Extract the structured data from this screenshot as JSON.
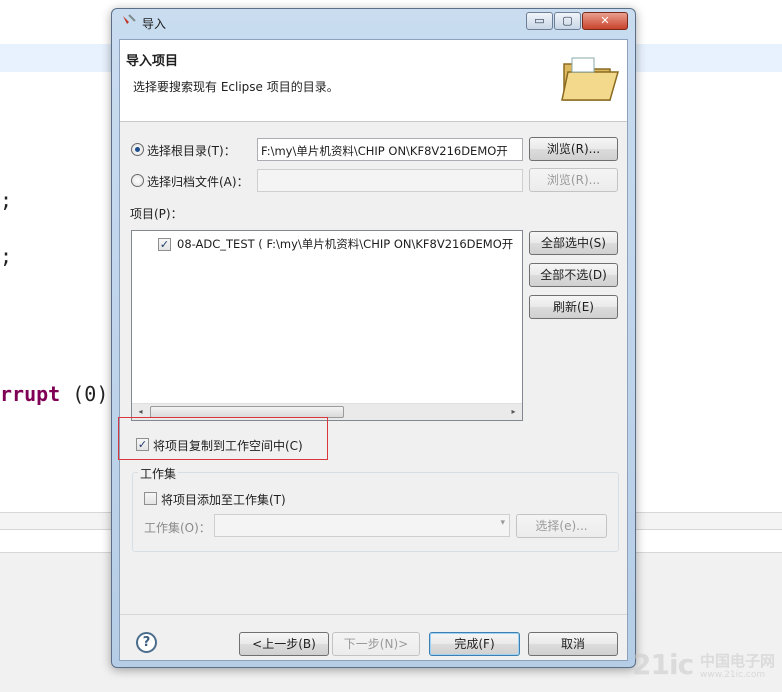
{
  "background_editor": {
    "code_lines": [
      ";",
      ";"
    ],
    "code_fragment_keyword": "rrupt",
    "code_fragment_args": "(0)"
  },
  "dialog": {
    "title": "导入",
    "window_buttons": {
      "minimize": "▭",
      "maximize": "▢",
      "close": "✕"
    },
    "header": {
      "title": "导入项目",
      "description": "选择要搜索现有 Eclipse 项目的目录。"
    },
    "root_dir": {
      "label": "选择根目录(T)：",
      "selected": true,
      "value": "F:\\my\\单片机资料\\CHIP ON\\KF8V216DEMO开",
      "browse_label": "浏览(R)..."
    },
    "archive": {
      "label": "选择归档文件(A)：",
      "selected": false,
      "value": "",
      "browse_label": "浏览(R)..."
    },
    "projects": {
      "label": "项目(P)：",
      "items": [
        {
          "checked": true,
          "text": "08-ADC_TEST ( F:\\my\\单片机资料\\CHIP ON\\KF8V216DEMO开"
        }
      ],
      "select_all_label": "全部选中(S)",
      "deselect_all_label": "全部不选(D)",
      "refresh_label": "刷新(E)",
      "scroll_left": "◂",
      "scroll_right": "▸"
    },
    "copy_into_workspace": {
      "checked": true,
      "label": "将项目复制到工作空间中(C)"
    },
    "working_sets": {
      "group_title": "工作集",
      "add_checkbox_label": "将项目添加至工作集(T)",
      "add_checked": false,
      "field_label": "工作集(O)：",
      "select_label": "选择(e)...",
      "combo_arrow": "▾"
    },
    "footer": {
      "help": "?",
      "back_label": "<上一步(B)",
      "next_label": "下一步(N)>",
      "finish_label": "完成(F)",
      "cancel_label": "取消"
    }
  },
  "watermark": {
    "logo": "21ic",
    "site": "中国电子网",
    "url": "www.21ic.com"
  },
  "colors": {
    "title_bar": "#b5cde6",
    "client_bg": "#f0f0f0",
    "highlight_border": "#d9363e",
    "keyword": "#7f0055"
  }
}
